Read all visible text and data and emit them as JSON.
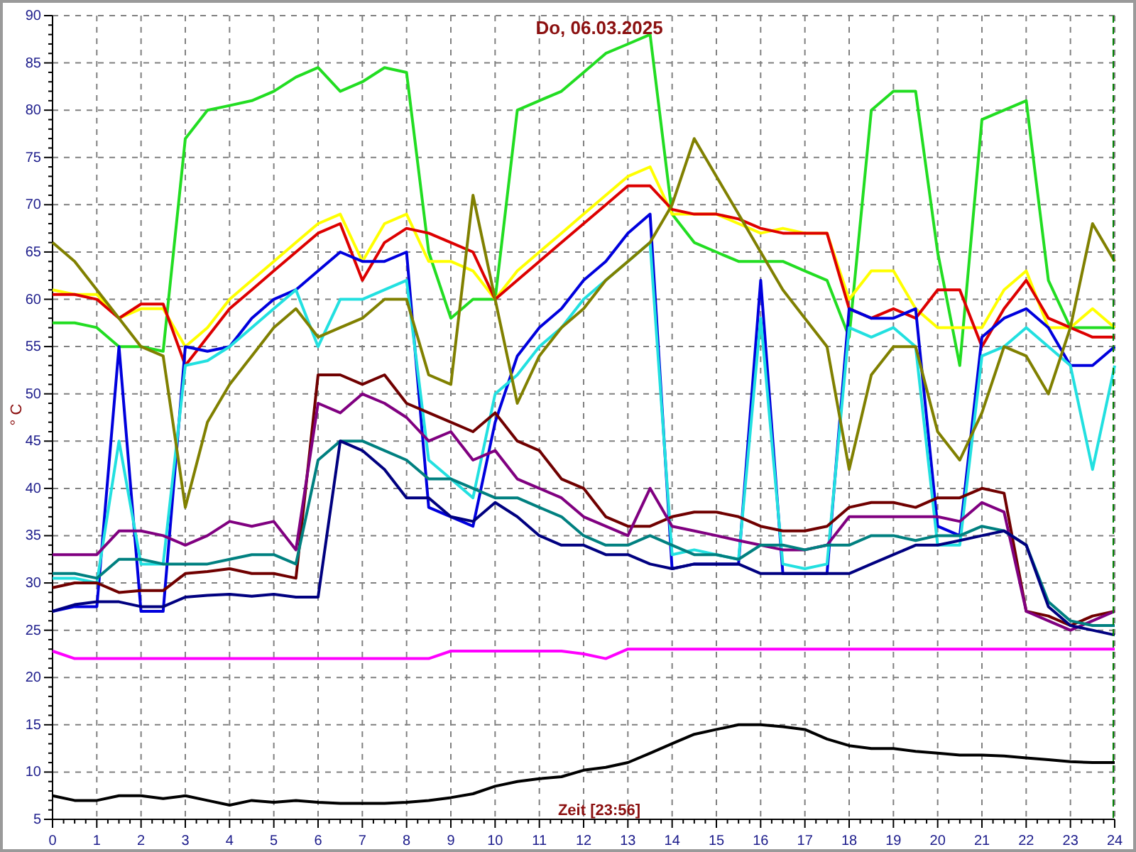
{
  "chart_data": {
    "type": "line",
    "title": "Do, 06.03.2025",
    "xlabel": "Zeit [23:56]",
    "ylabel": "° C",
    "x": [
      0,
      0.5,
      1,
      1.5,
      2,
      2.5,
      3,
      3.5,
      4,
      4.5,
      5,
      5.5,
      6,
      6.5,
      7,
      7.5,
      8,
      8.5,
      9,
      9.5,
      10,
      10.5,
      11,
      11.5,
      12,
      12.5,
      13,
      13.5,
      14,
      14.5,
      15,
      15.5,
      16,
      16.5,
      17,
      17.5,
      18,
      18.5,
      19,
      19.5,
      20,
      20.5,
      21,
      21.5,
      22,
      22.5,
      23,
      23.5,
      24
    ],
    "xlim": [
      0,
      24
    ],
    "ylim": [
      5,
      90
    ],
    "xticks": [
      0,
      1,
      2,
      3,
      4,
      5,
      6,
      7,
      8,
      9,
      10,
      11,
      12,
      13,
      14,
      15,
      16,
      17,
      18,
      19,
      20,
      21,
      22,
      23,
      24
    ],
    "yticks": [
      5,
      10,
      15,
      20,
      25,
      30,
      35,
      40,
      45,
      50,
      55,
      60,
      65,
      70,
      75,
      80,
      85,
      90
    ],
    "series": [
      {
        "color": "#22dd22",
        "values": [
          57.5,
          57.5,
          57,
          55,
          55,
          54.5,
          77,
          80,
          80.5,
          81,
          82,
          83.5,
          84.5,
          82,
          83,
          84.5,
          84,
          65,
          58,
          60,
          60,
          80,
          81,
          82,
          84,
          86,
          87,
          88,
          69,
          66,
          65,
          64,
          64,
          64,
          63,
          62,
          56,
          80,
          82,
          82,
          65,
          53,
          79,
          80,
          81,
          62,
          57,
          57,
          57
        ]
      },
      {
        "color": "#ffff00",
        "values": [
          61,
          60.5,
          60.5,
          58,
          59,
          59,
          55,
          57,
          60,
          62,
          64,
          66,
          68,
          69,
          64,
          68,
          69,
          64,
          64,
          63,
          60,
          63,
          65,
          67,
          69,
          71,
          73,
          74,
          69,
          69,
          69,
          68,
          67,
          67.5,
          67,
          67,
          60,
          63,
          63,
          59,
          57,
          57,
          57,
          61,
          63,
          57,
          57,
          59,
          57
        ]
      },
      {
        "color": "#dd0000",
        "values": [
          60.5,
          60.5,
          60,
          58,
          59.5,
          59.5,
          53,
          56,
          59,
          61,
          63,
          65,
          67,
          68,
          62,
          66,
          67.5,
          67,
          66,
          65,
          60,
          62,
          64,
          66,
          68,
          70,
          72,
          72,
          69.5,
          69,
          69,
          68.5,
          67.5,
          67,
          67,
          67,
          59,
          58,
          59,
          58,
          61,
          61,
          55,
          59,
          62,
          58,
          57,
          56,
          56
        ]
      },
      {
        "color": "#0000dd",
        "values": [
          27,
          27.5,
          27.5,
          55,
          27,
          27,
          55,
          54.5,
          55,
          58,
          60,
          61,
          63,
          65,
          64,
          64,
          65,
          38,
          37,
          36,
          47,
          54,
          57,
          59,
          62,
          64,
          67,
          69,
          31.5,
          32,
          32,
          32,
          62,
          31,
          31,
          31,
          59,
          58,
          58,
          59,
          36,
          35,
          56,
          58,
          59,
          57,
          53,
          53,
          55
        ]
      },
      {
        "color": "#22e0e0",
        "values": [
          30.5,
          30.5,
          30,
          45,
          32,
          32,
          53,
          53.5,
          55,
          57,
          59,
          61,
          55,
          60,
          60,
          61,
          62,
          43,
          41,
          39,
          50,
          52,
          55,
          57,
          60,
          62,
          64,
          66,
          33,
          33.5,
          33,
          32.5,
          58,
          32,
          31.5,
          32,
          57,
          56,
          57,
          55,
          34,
          34,
          54,
          55,
          57,
          55,
          53,
          42,
          53
        ]
      },
      {
        "color": "#808000",
        "values": [
          66,
          64,
          61,
          58,
          55,
          54,
          38,
          47,
          51,
          54,
          57,
          59,
          56,
          57,
          58,
          60,
          60,
          52,
          51,
          71,
          60,
          49,
          54,
          57,
          59,
          62,
          64,
          66,
          70,
          77,
          73,
          69,
          65,
          61,
          58,
          55,
          42,
          52,
          55,
          55,
          46,
          43,
          48,
          55,
          54,
          50,
          57,
          68,
          64
        ]
      },
      {
        "color": "#700000",
        "values": [
          29.5,
          30,
          30,
          29,
          29.2,
          29.2,
          31,
          31.2,
          31.5,
          31,
          31,
          30.5,
          52,
          52,
          51,
          52,
          49,
          48,
          47,
          46,
          48,
          45,
          44,
          41,
          40,
          37,
          36,
          36,
          37,
          37.5,
          37.5,
          37,
          36,
          35.5,
          35.5,
          36,
          38,
          38.5,
          38.5,
          38,
          39,
          39,
          40,
          39.5,
          27,
          26.5,
          25.5,
          26.5,
          27
        ]
      },
      {
        "color": "#800080",
        "values": [
          33,
          33,
          33,
          35.5,
          35.5,
          35,
          34,
          35,
          36.5,
          36,
          36.5,
          33.5,
          49,
          48,
          50,
          49,
          47.5,
          45,
          46,
          43,
          44,
          41,
          40,
          39,
          37,
          36,
          35,
          40,
          36,
          35.5,
          35,
          34.5,
          34,
          33.5,
          33.5,
          34,
          37,
          37,
          37,
          37,
          37,
          36.5,
          38.5,
          37.5,
          27,
          26,
          25,
          26,
          27
        ]
      },
      {
        "color": "#008080",
        "values": [
          31,
          31,
          30.5,
          32.5,
          32.5,
          32,
          32,
          32,
          32.5,
          33,
          33,
          32,
          43,
          45,
          45,
          44,
          43,
          41,
          41,
          40,
          39,
          39,
          38,
          37,
          35,
          34,
          34,
          35,
          34,
          33,
          33,
          32.5,
          34,
          34,
          33.5,
          34,
          34,
          35,
          35,
          34.5,
          35,
          35,
          36,
          35.5,
          34,
          28,
          26,
          25.5,
          25.5
        ]
      },
      {
        "color": "#000080",
        "values": [
          27,
          27.7,
          28,
          28,
          27.5,
          27.5,
          28.5,
          28.7,
          28.8,
          28.6,
          28.8,
          28.5,
          28.5,
          45,
          44,
          42,
          39,
          39,
          37,
          36.5,
          38.5,
          37,
          35,
          34,
          34,
          33,
          33,
          32,
          31.5,
          32,
          32,
          32,
          31,
          31,
          31,
          31,
          31,
          32,
          33,
          34,
          34,
          34.5,
          35,
          35.5,
          34,
          27.5,
          25.5,
          25,
          24.5
        ]
      },
      {
        "color": "#ff00ff",
        "values": [
          22.8,
          22,
          22,
          22,
          22,
          22,
          22,
          22,
          22,
          22,
          22,
          22,
          22,
          22,
          22,
          22,
          22,
          22,
          22.8,
          22.8,
          22.8,
          22.8,
          22.8,
          22.8,
          22.5,
          22,
          23,
          23,
          23,
          23,
          23,
          23,
          23,
          23,
          23,
          23,
          23,
          23,
          23,
          23,
          23,
          23,
          23,
          23,
          23,
          23,
          23,
          23,
          23
        ]
      },
      {
        "color": "#000000",
        "values": [
          7.5,
          7,
          7,
          7.5,
          7.5,
          7.2,
          7.5,
          7,
          6.5,
          7,
          6.8,
          7,
          6.8,
          6.7,
          6.7,
          6.7,
          6.8,
          7,
          7.3,
          7.7,
          8.5,
          9,
          9.3,
          9.5,
          10.2,
          10.5,
          11,
          12,
          13,
          14,
          14.5,
          15,
          15,
          14.8,
          14.5,
          13.5,
          12.8,
          12.5,
          12.5,
          12.2,
          12,
          11.8,
          11.8,
          11.7,
          11.5,
          11.3,
          11.1,
          11,
          11
        ]
      }
    ],
    "grid": true
  }
}
